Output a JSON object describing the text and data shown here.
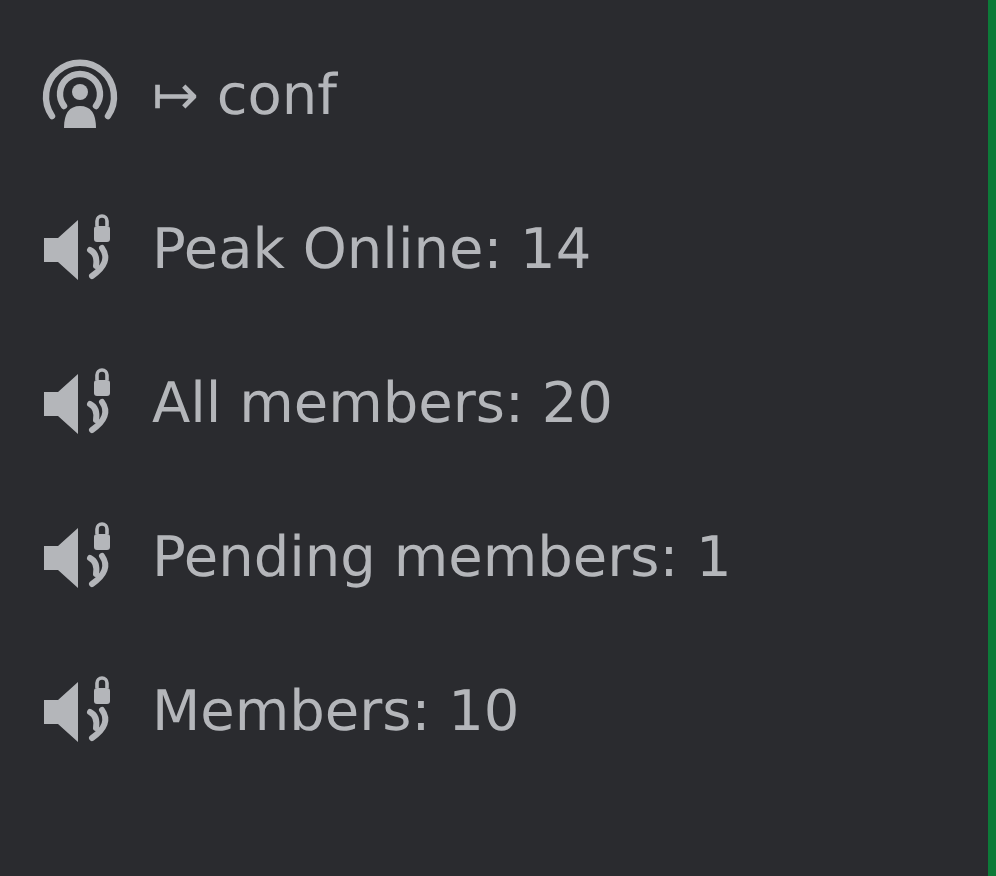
{
  "channels": [
    {
      "kind": "stage",
      "name": "↦ conf"
    },
    {
      "kind": "voice-locked",
      "name": "Peak Online: 14"
    },
    {
      "kind": "voice-locked",
      "name": "All members: 20"
    },
    {
      "kind": "voice-locked",
      "name": "Pending members: 1"
    },
    {
      "kind": "voice-locked",
      "name": "Members: 10"
    }
  ]
}
